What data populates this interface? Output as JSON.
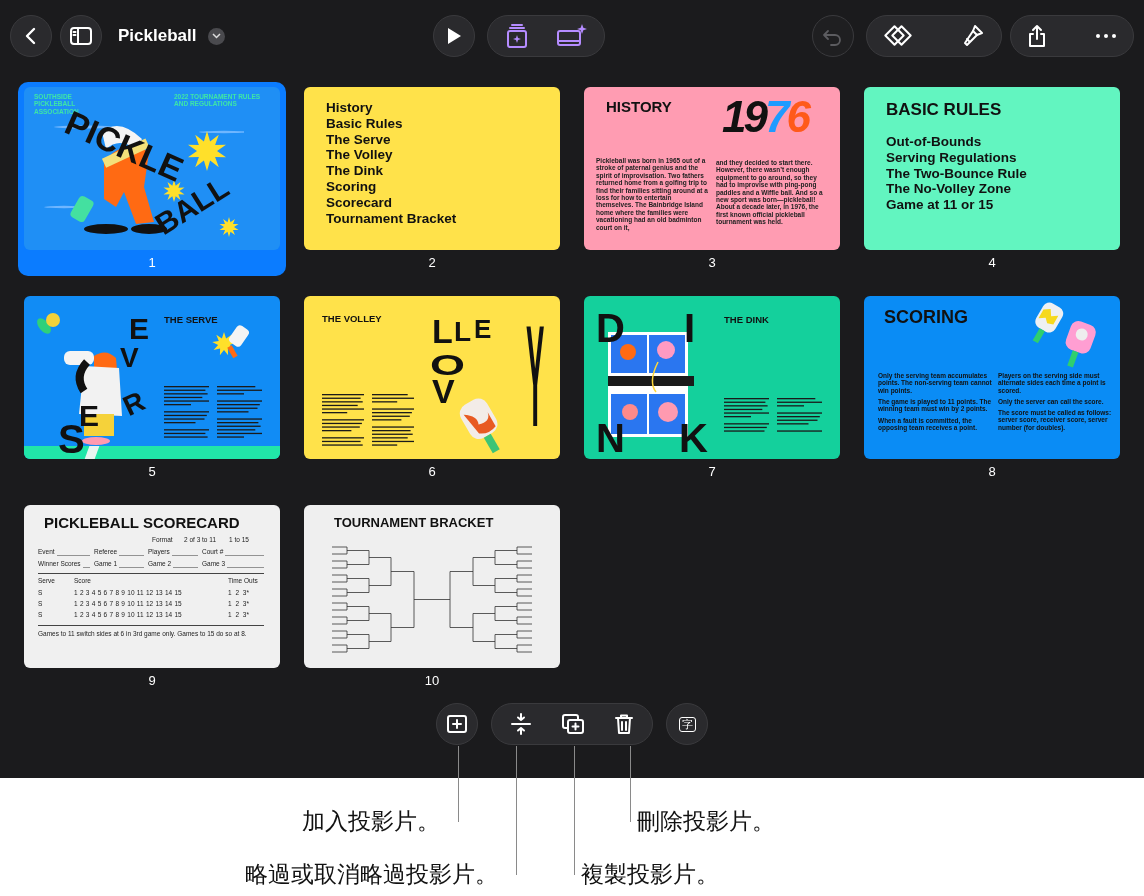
{
  "toolbar": {
    "title": "Pickleball",
    "undo": {
      "disabled": true
    }
  },
  "slides": [
    {
      "number": "1",
      "selected": true,
      "kind": "title",
      "color": "#1f8ff5",
      "org": "SOUTHSIDE PICKLEBALL ASSOCIATION",
      "subtitle": "2022 TOURNAMENT RULES AND REGULATIONS",
      "words": [
        "PICKLE",
        "BALL"
      ]
    },
    {
      "number": "2",
      "selected": false,
      "kind": "list",
      "color": "#ffe24a",
      "items": [
        "History",
        "Basic Rules",
        "The Serve",
        "The Volley",
        "The Dink",
        "Scoring",
        "Scorecard",
        "Tournament Bracket"
      ]
    },
    {
      "number": "3",
      "selected": false,
      "kind": "history",
      "color": "#ff9cb2",
      "title": "HISTORY",
      "year_parts": [
        {
          "text": "19",
          "color": "#111111"
        },
        {
          "text": "7",
          "color": "#1e9bff"
        },
        {
          "text": "6",
          "color": "#ff5a1a"
        }
      ],
      "paragraphs": [
        "Pickleball was born in 1965 out of a stroke of paternal genius and the spirit of improvisation. Two fathers returned home from a golfing trip to find their families sitting around at a loss for how to entertain themselves. The Bainbridge Island home where the families were vacationing had an old badminton court on it,",
        "and they decided to start there. However, there wasn’t enough equipment to go around, so they had to improvise with ping-pong paddles and a Wiffle ball. And so a new sport was born—pickleball! About a decade later, in 1976, the first known official pickleball tournament was held."
      ]
    },
    {
      "number": "4",
      "selected": false,
      "kind": "list",
      "color": "#62f5c0",
      "title": "BASIC RULES",
      "items": [
        "Out-of-Bounds",
        "Serving Regulations",
        "The Two-Bounce Rule",
        "The No-Volley Zone",
        "Game at 11 or 15"
      ]
    },
    {
      "number": "5",
      "selected": false,
      "kind": "serve",
      "color": "#118cf5",
      "title": "THE SERVE",
      "letters": [
        "E",
        "V",
        "R",
        "E",
        "S"
      ]
    },
    {
      "number": "6",
      "selected": false,
      "kind": "volley",
      "color": "#ffe24a",
      "title": "THE VOLLEY",
      "letters": [
        "L",
        "L",
        "E",
        "O",
        "V",
        "Y"
      ]
    },
    {
      "number": "7",
      "selected": false,
      "kind": "dink",
      "color": "#14d09c",
      "title": "THE DINK",
      "letters": [
        "D",
        "I",
        "N",
        "K"
      ]
    },
    {
      "number": "8",
      "selected": false,
      "kind": "scoring",
      "color": "#0a8cf5",
      "title": "SCORING",
      "columns": [
        [
          "Only the serving team accumulates points. The non-serving team cannot win points.",
          "The game is played to 11 points. The winning team must win by 2 points.",
          "When a fault is committed, the opposing team receives a point."
        ],
        [
          "Players on the serving side must alternate sides each time a point is scored.",
          "Only the server can call the score.",
          "The score must be called as follows: server score, receiver score, server number (for doubles)."
        ]
      ]
    },
    {
      "number": "9",
      "selected": false,
      "kind": "scorecard",
      "color": "#f0f0f0",
      "title": "PICKLEBALL SCORECARD",
      "format": [
        "Format",
        "2 of 3 to 11",
        "1 to 15"
      ],
      "fields": [
        "Event",
        "Referee",
        "Players",
        "Court #",
        "Winner Scores",
        "Game 1",
        "Game 2",
        "Game 3"
      ],
      "headers": [
        "Serve",
        "Score",
        "Time Outs"
      ],
      "rows": [
        {
          "serve": "S",
          "scores": "1 2 3 4 5 6 7 8 9 10 11 12 13 14 15",
          "timeouts": "1 2 3*"
        },
        {
          "serve": "S",
          "scores": "1 2 3 4 5 6 7 8 9 10 11 12 13 14 15",
          "timeouts": "1 2 3*"
        },
        {
          "serve": "S",
          "scores": "1 2 3 4 5 6 7 8 9 10 11 12 13 14 15",
          "timeouts": "1 2 3*"
        }
      ],
      "footer": "Games to 11 switch sides at 6 in 3rd game only. Games to 15 do so at 8."
    },
    {
      "number": "10",
      "selected": false,
      "kind": "bracket",
      "color": "#efefef",
      "title": "TOURNAMENT BRACKET"
    }
  ],
  "text_button": {
    "label": "字"
  },
  "callouts": [
    {
      "text": "加入投影片。"
    },
    {
      "text": "刪除投影片。"
    },
    {
      "text": "略過或取消略過投影片。"
    },
    {
      "text": "複製投影片。"
    }
  ]
}
